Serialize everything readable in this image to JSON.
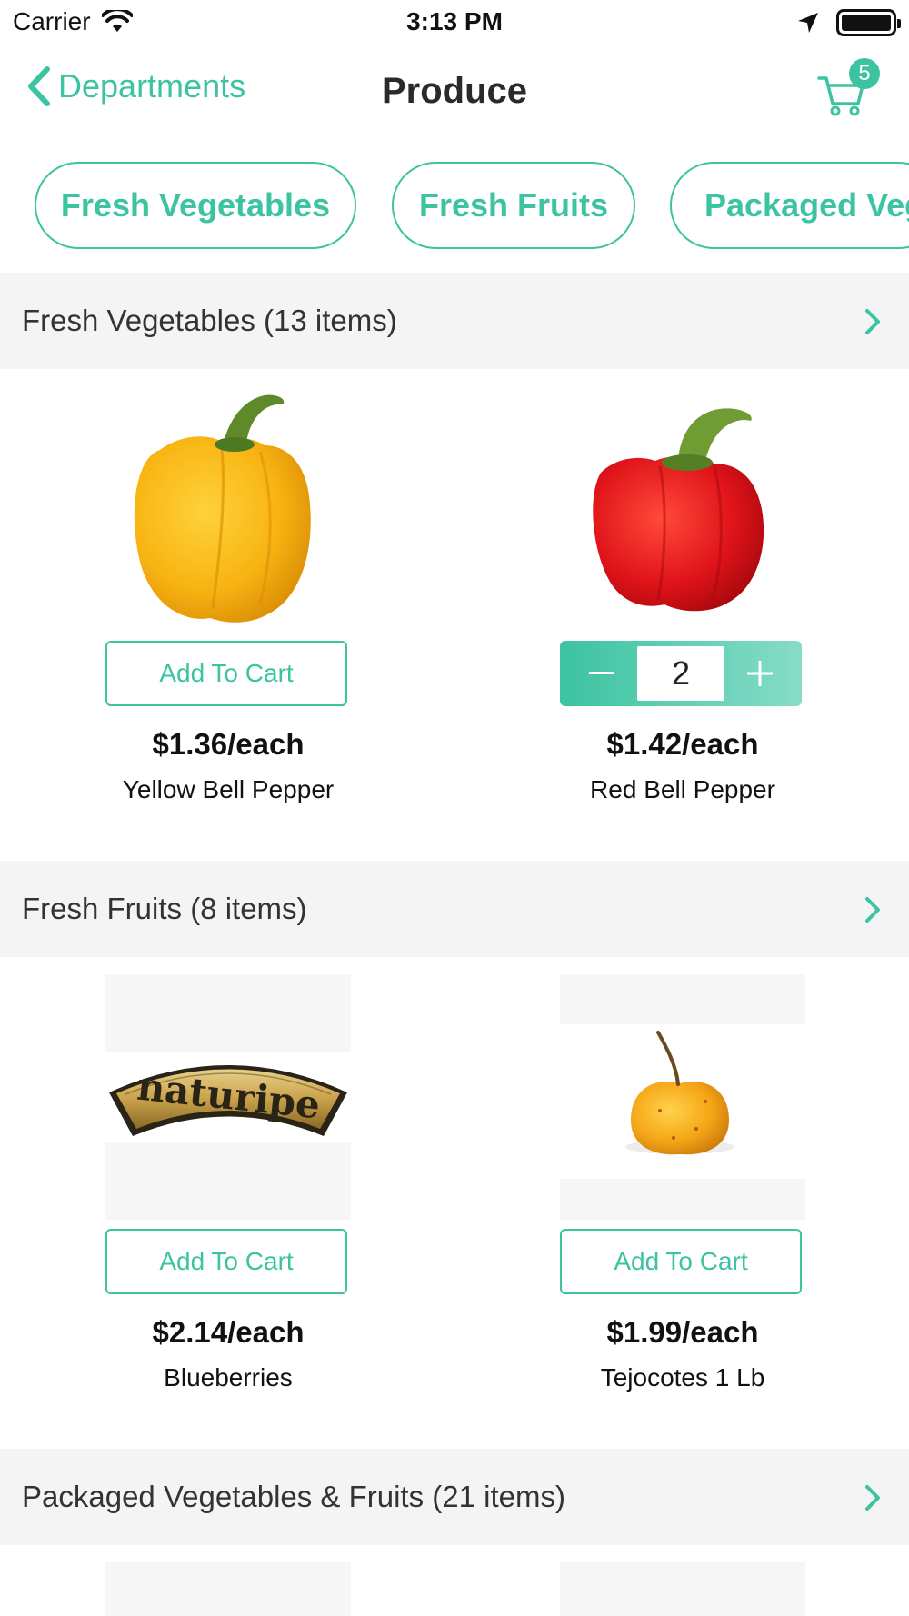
{
  "status_bar": {
    "carrier": "Carrier",
    "time": "3:13 PM"
  },
  "nav": {
    "back_label": "Departments",
    "title": "Produce",
    "cart_count": "5"
  },
  "chips": [
    "Fresh Vegetables",
    "Fresh Fruits",
    "Packaged Veg"
  ],
  "sections": [
    {
      "title": "Fresh Vegetables (13 items)"
    },
    {
      "title": "Fresh Fruits (8 items)"
    },
    {
      "title": "Packaged Vegetables & Fruits (21 items)"
    }
  ],
  "products": [
    {
      "name": "Yellow Bell Pepper",
      "price": "$1.36/each",
      "action": "Add To Cart"
    },
    {
      "name": "Red Bell Pepper",
      "price": "$1.42/each",
      "quantity": "2"
    },
    {
      "name": "Blueberries",
      "price": "$2.14/each",
      "action": "Add To Cart",
      "logo_text": "naturipe"
    },
    {
      "name": "Tejocotes 1 Lb",
      "price": "$1.99/each",
      "action": "Add To Cart"
    }
  ],
  "colors": {
    "accent": "#3cc3a1",
    "header_bg": "#f4f4f4"
  }
}
